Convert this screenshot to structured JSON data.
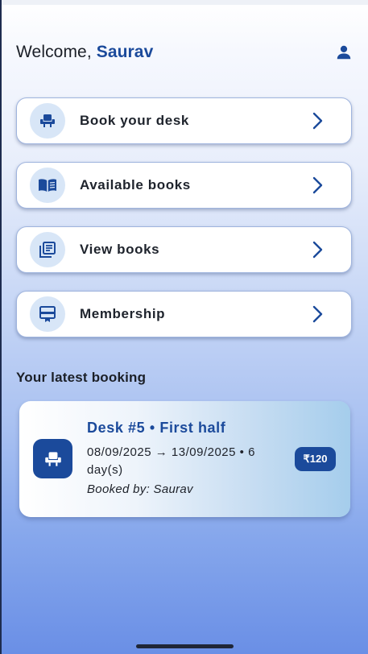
{
  "header": {
    "greeting": "Welcome,",
    "user_name": "Saurav",
    "profile_icon": "person-icon"
  },
  "menu": {
    "items": [
      {
        "label": "Book your desk",
        "icon": "desk-chair-icon"
      },
      {
        "label": "Available books",
        "icon": "open-book-icon"
      },
      {
        "label": "View books",
        "icon": "library-books-icon"
      },
      {
        "label": "Membership",
        "icon": "membership-card-icon"
      }
    ]
  },
  "latest_booking": {
    "section_title": "Your latest booking",
    "title": "Desk #5 • First half",
    "dates": "08/09/2025 → 13/09/2025 • 6 day(s)",
    "booked_by": "Booked by: Saurav",
    "price": "₹120",
    "icon": "desk-chair-icon"
  },
  "colors": {
    "primary": "#1b4a9b",
    "icon_bubble": "#d8e6f7",
    "card_border": "#9fb4de"
  }
}
